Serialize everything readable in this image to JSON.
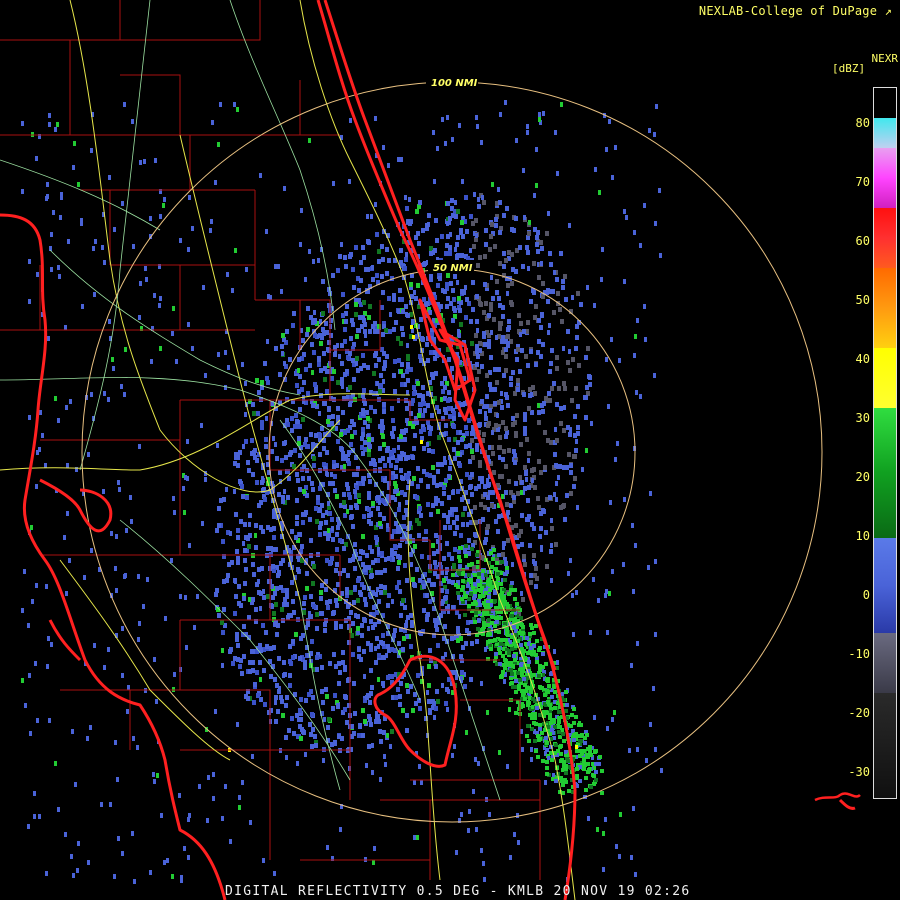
{
  "header": {
    "credit": "NEXLAB-College of DuPage"
  },
  "legend": {
    "product": "NEXR",
    "units": "[dBZ]",
    "ticks": [
      "80",
      "70",
      "60",
      "50",
      "40",
      "30",
      "20",
      "10",
      "0",
      "-10",
      "-20",
      "-30"
    ],
    "colors": {
      "v80": "#40e8ee",
      "v70": "#ff44ff",
      "v60": "#ff2222",
      "v50": "#ff6a00",
      "v35": "#ffff00",
      "v20": "#22cc33",
      "v10": "#117722",
      "v0": "#4a63d8",
      "vneg10": "#555566",
      "vneg30": "#111111"
    }
  },
  "map": {
    "range_rings": [
      "50 NMI",
      "100 NMI"
    ],
    "county_line_color": "#b01010",
    "coast_color": "#ff2020",
    "road_color_major": "#e6e64a",
    "road_color_minor": "#9be0a0"
  },
  "footer": {
    "caption": "DIGITAL REFLECTIVITY 0.5 DEG - KMLB 20 NOV 19 02:26"
  }
}
